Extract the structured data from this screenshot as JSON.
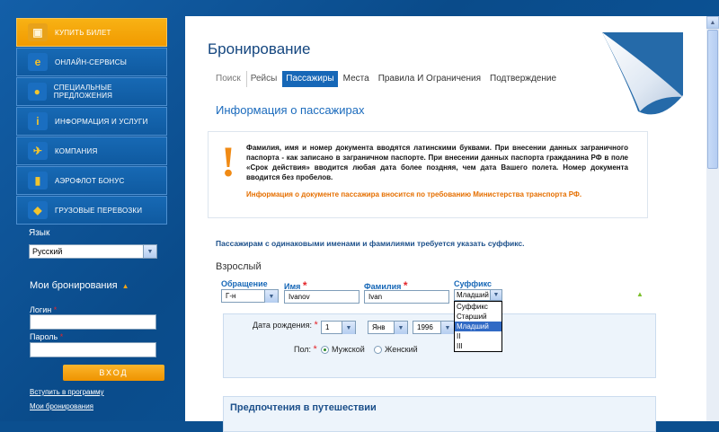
{
  "sidebar": {
    "menu": [
      {
        "label": "КУПИТЬ БИЛЕТ",
        "icon": "ticket-icon",
        "active": true
      },
      {
        "label": "ОНЛАЙН-СЕРВИСЫ",
        "icon": "internet-icon"
      },
      {
        "label": "СПЕЦИАЛЬНЫЕ ПРЕДЛОЖЕНИЯ",
        "icon": "coins-icon"
      },
      {
        "label": "ИНФОРМАЦИЯ И УСЛУГИ",
        "icon": "info-icon"
      },
      {
        "label": "КОМПАНИЯ",
        "icon": "airplane-icon"
      },
      {
        "label": "АЭРОФЛОТ БОНУС",
        "icon": "bonus-icon"
      },
      {
        "label": "ГРУЗОВЫЕ ПЕРЕВОЗКИ",
        "icon": "cargo-icon"
      }
    ],
    "lang_label": "Язык",
    "lang_value": "Русский",
    "my_bookings_title": "Мои бронирования",
    "login_label": "Логин",
    "password_label": "Пароль",
    "enter_button": "ВХОД",
    "join_link": "Вступить в программу",
    "bookings_link": "Мои бронирования"
  },
  "main": {
    "title": "Бронирование",
    "tabs": [
      "Поиск",
      "Рейсы",
      "Пассажиры",
      "Места",
      "Правила И Ограничения",
      "Подтверждение"
    ],
    "active_tab": "Пассажиры",
    "section_title": "Информация о пассажирах",
    "notice_text": "Фамилия, имя и номер документа вводятся латинскими буквами. При внесении данных заграничного паспорта - как записано в заграничном паспорте. При внесении данных паспорта гражданина РФ в поле «Срок действия» вводится любая дата более поздняя, чем дата Вашего полета. Номер документа вводится без пробелов.",
    "notice_note": "Информация о документе пассажира вносится по требованию Министерства транспорта РФ.",
    "suffix_hint": "Пассажирам с одинаковыми именами и фамилиями требуется указать суффикс.",
    "passenger_type": "Взрослый",
    "fields": {
      "title_label": "Обращение",
      "title_value": "Г-н",
      "first_name_label": "Имя",
      "first_name_value": "Ivanov",
      "last_name_label": "Фамилия",
      "last_name_value": "Ivan",
      "suffix_label": "Суффикс",
      "suffix_value": "Младший",
      "suffix_options": [
        "Суффикс",
        "Старший",
        "Младший",
        "II",
        "III"
      ],
      "suffix_selected_index": 2
    },
    "birth": {
      "label": "Дата рождения:",
      "day": "1",
      "month": "Янв",
      "year": "1996"
    },
    "gender": {
      "label": "Пол:",
      "male": "Мужской",
      "female": "Женский",
      "selected": "male"
    },
    "preferences_title": "Предпочтения в путешествии"
  }
}
